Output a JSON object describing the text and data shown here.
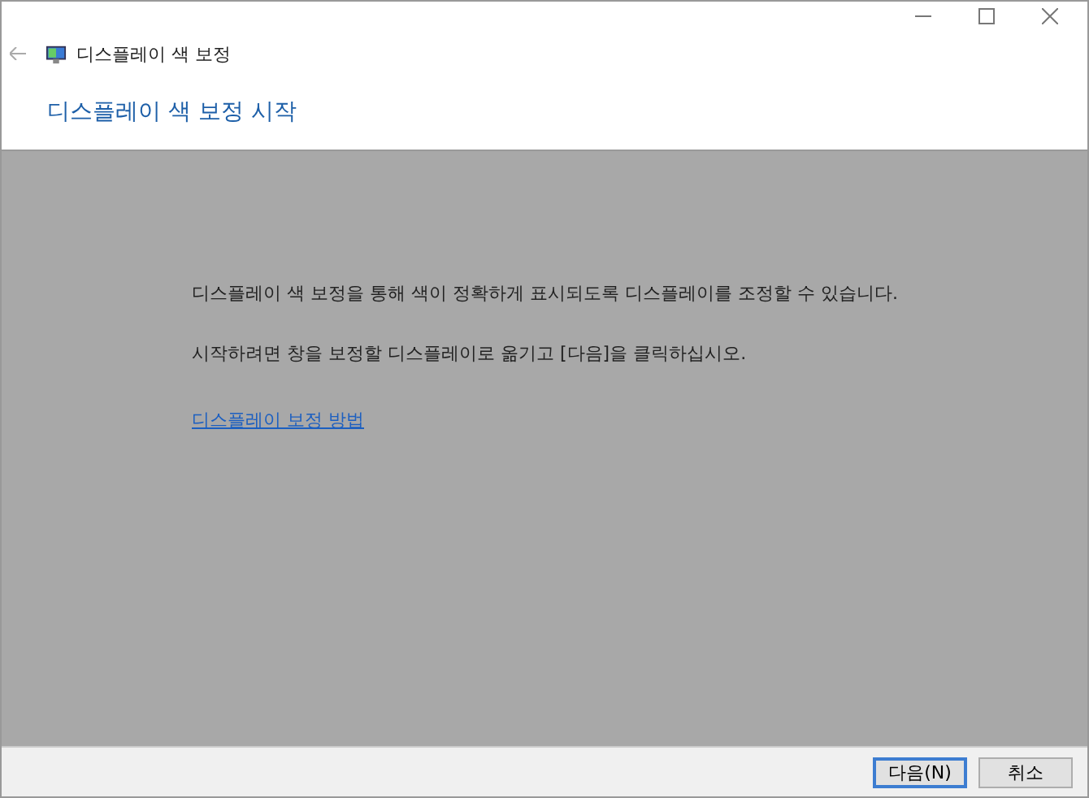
{
  "window": {
    "title": "디스플레이 색 보정"
  },
  "heading": "디스플레이 색 보정 시작",
  "paragraphs": [
    "디스플레이 색 보정을 통해 색이 정확하게 표시되도록 디스플레이를 조정할 수 있습니다.",
    "시작하려면 창을 보정할 디스플레이로 옮기고 [다음]을 클릭하십시오."
  ],
  "link": "디스플레이 보정 방법",
  "buttons": [
    {
      "label": "다음(N)",
      "default": true
    },
    {
      "label": "취소",
      "default": false
    }
  ]
}
